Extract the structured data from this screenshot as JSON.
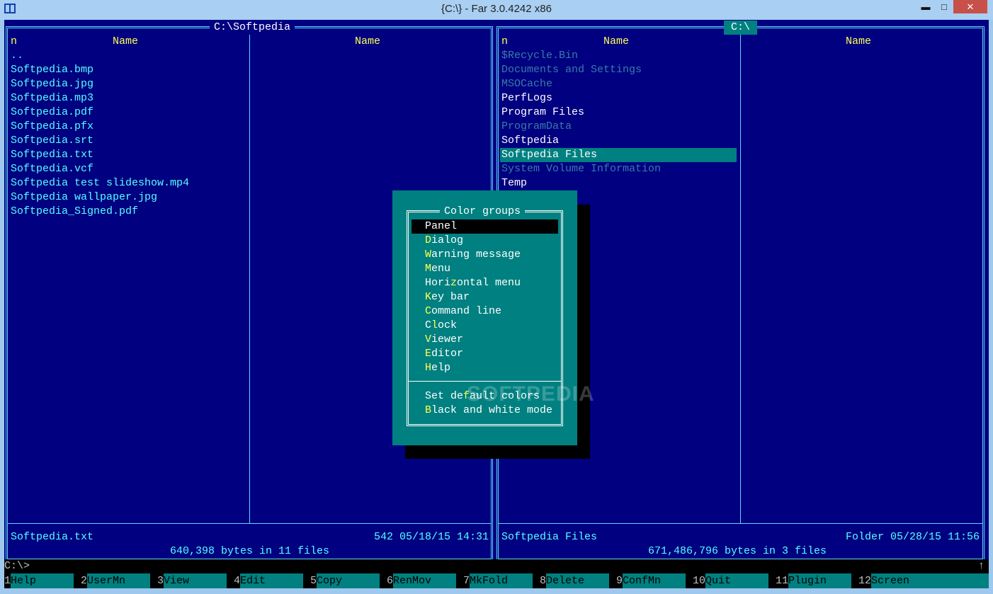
{
  "window": {
    "title": "{C:\\} - Far 3.0.4242 x86",
    "icon": "far-manager-icon",
    "min": "▬",
    "max": "□",
    "close": "✕"
  },
  "left_panel": {
    "path": "C:\\Softpedia",
    "col_n": "n",
    "col_name_1": "Name",
    "col_name_2": "Name",
    "files": [
      "..",
      "Softpedia.bmp",
      "Softpedia.jpg",
      "Softpedia.mp3",
      "Softpedia.pdf",
      "Softpedia.pfx",
      "Softpedia.srt",
      "Softpedia.txt",
      "Softpedia.vcf",
      "Softpedia test slideshow.mp4",
      "Softpedia wallpaper.jpg",
      "Softpedia_Signed.pdf"
    ],
    "status_name": "Softpedia.txt",
    "status_info": "542 05/18/15 14:31",
    "summary": "640,398 bytes in 11 files"
  },
  "right_panel": {
    "path": "C:\\",
    "col_n": "n",
    "col_name_1": "Name",
    "col_name_2": "Name",
    "files": [
      "$Recycle.Bin",
      "Documents and Settings",
      "MSOCache",
      "PerfLogs",
      "Program Files",
      "ProgramData",
      "Softpedia",
      "Softpedia Files",
      "System Volume Information",
      "Temp"
    ],
    "status_name": "Softpedia Files",
    "status_info": "Folder 05/28/15 11:56",
    "summary": "671,486,796 bytes in 3 files"
  },
  "dialog": {
    "title": "Color groups",
    "items": [
      {
        "pre": "",
        "hot": "",
        "post": "Panel"
      },
      {
        "pre": "",
        "hot": "D",
        "post": "ialog"
      },
      {
        "pre": "",
        "hot": "W",
        "post": "arning message"
      },
      {
        "pre": "",
        "hot": "M",
        "post": "enu"
      },
      {
        "pre": "Hori",
        "hot": "z",
        "post": "ontal menu"
      },
      {
        "pre": "",
        "hot": "K",
        "post": "ey bar"
      },
      {
        "pre": "",
        "hot": "C",
        "post": "ommand line"
      },
      {
        "pre": "C",
        "hot": "l",
        "post": "ock"
      },
      {
        "pre": "",
        "hot": "V",
        "post": "iewer"
      },
      {
        "pre": "",
        "hot": "E",
        "post": "ditor"
      },
      {
        "pre": "",
        "hot": "H",
        "post": "elp"
      }
    ],
    "extra_items": [
      {
        "pre": "Set de",
        "hot": "f",
        "post": "ault colors"
      },
      {
        "pre": "",
        "hot": "B",
        "post": "lack and white mode"
      }
    ],
    "watermark": "SOFTPEDIA"
  },
  "command_line": {
    "prompt": "C:\\>",
    "scroll_glyph": "↑"
  },
  "keybar": [
    {
      "num": "1",
      "label": "Help"
    },
    {
      "num": "2",
      "label": "UserMn"
    },
    {
      "num": "3",
      "label": "View"
    },
    {
      "num": "4",
      "label": "Edit"
    },
    {
      "num": "5",
      "label": "Copy"
    },
    {
      "num": "6",
      "label": "RenMov"
    },
    {
      "num": "7",
      "label": "MkFold"
    },
    {
      "num": "8",
      "label": "Delete"
    },
    {
      "num": "9",
      "label": "ConfMn"
    },
    {
      "num": "10",
      "label": "Quit"
    },
    {
      "num": "11",
      "label": "Plugin"
    },
    {
      "num": "12",
      "label": "Screen"
    }
  ],
  "colors": {
    "panel_bg": "#000080",
    "frame": "#5fd7ff",
    "file_text": "#55ffff",
    "header_text": "#ffff55",
    "selection": "#008080",
    "hidden_text": "#3a7aa8"
  }
}
